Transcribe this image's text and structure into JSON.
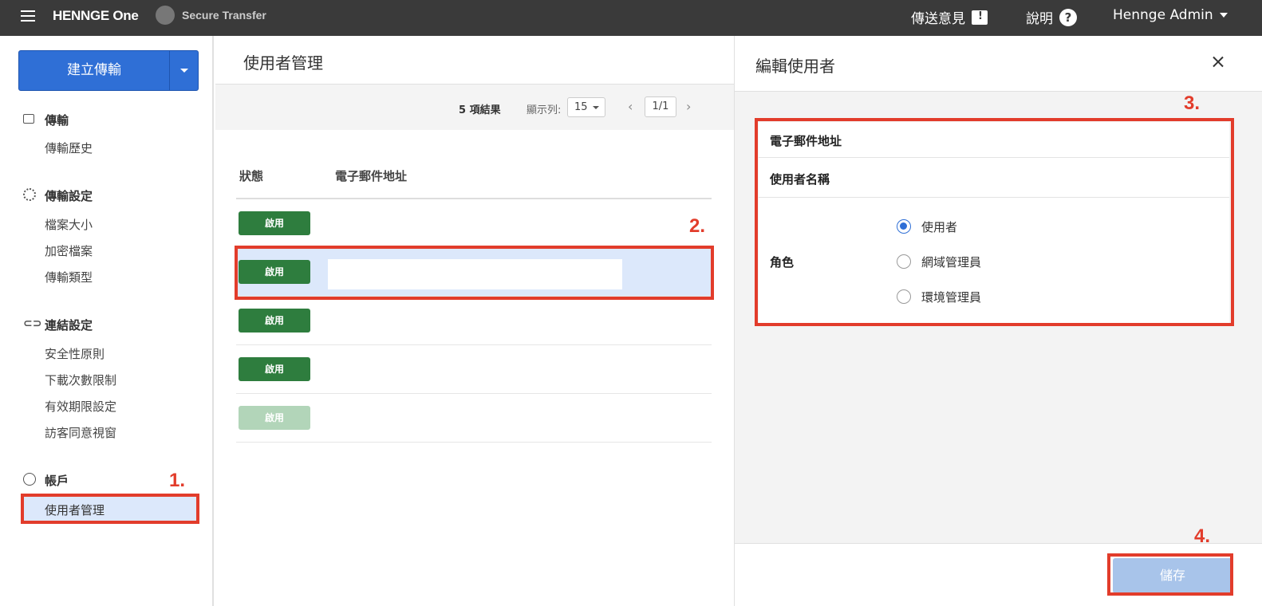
{
  "topbar": {
    "brand": "HENNGE One",
    "product": "Secure Transfer",
    "feedback": "傳送意見",
    "help": "說明",
    "user": "Hennge Admin"
  },
  "sidebar": {
    "create_button": "建立傳輸",
    "sections": [
      {
        "title": "傳輸",
        "items": [
          "傳輸歷史"
        ]
      },
      {
        "title": "傳輸設定",
        "items": [
          "檔案大小",
          "加密檔案",
          "傳輸類型"
        ]
      },
      {
        "title": "連結設定",
        "items": [
          "安全性原則",
          "下載次數限制",
          "有效期限設定",
          "訪客同意視窗"
        ]
      },
      {
        "title": "帳戶",
        "items": [
          "使用者管理"
        ]
      }
    ]
  },
  "main": {
    "title": "使用者管理",
    "results": "5 項結果",
    "rows_label": "顯示列:",
    "rows_value": "15",
    "page": "1/1",
    "columns": {
      "status": "狀態",
      "email": "電子郵件地址"
    },
    "rows": [
      {
        "status": "啟用",
        "email": ""
      },
      {
        "status": "啟用",
        "email": ""
      },
      {
        "status": "啟用",
        "email": ""
      },
      {
        "status": "啟用",
        "email": ""
      },
      {
        "status": "啟用",
        "email": ""
      }
    ]
  },
  "panel": {
    "title": "編輯使用者",
    "email_label": "電子郵件地址",
    "name_label": "使用者名稱",
    "role_label": "角色",
    "roles": [
      "使用者",
      "網域管理員",
      "環境管理員"
    ],
    "selected_role": "使用者",
    "save": "儲存"
  },
  "annotations": {
    "m1": "1.",
    "m2": "2.",
    "m3": "3.",
    "m4": "4."
  },
  "colors": {
    "accent": "#2f6fd6",
    "enabled": "#2e7d3e",
    "highlight": "#e23c2b"
  }
}
